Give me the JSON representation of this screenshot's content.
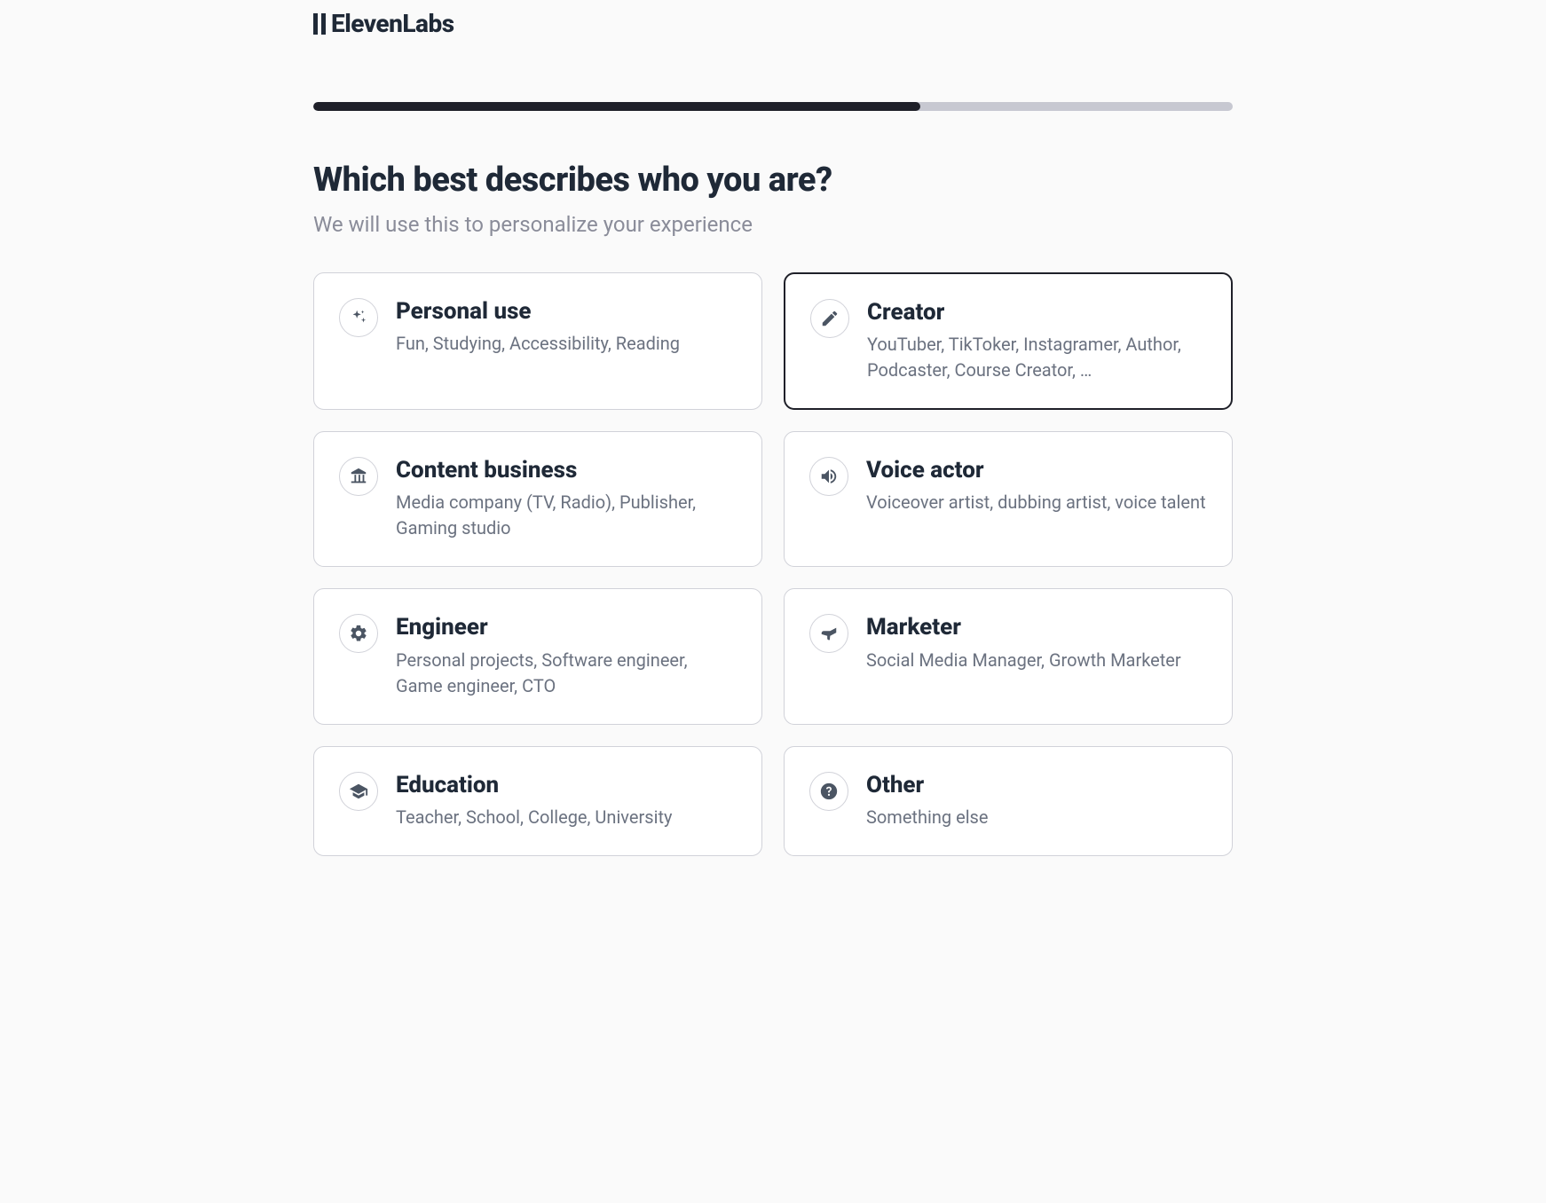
{
  "brand": "ElevenLabs",
  "progress": {
    "percent": 66
  },
  "heading": "Which best describes who you are?",
  "subheading": "We will use this to personalize your experience",
  "selected": "creator",
  "options": {
    "personal": {
      "title": "Personal use",
      "desc": "Fun, Studying, Accessibility, Reading"
    },
    "creator": {
      "title": "Creator",
      "desc": "YouTuber, TikToker, Instagramer, Author, Podcaster, Course Creator, …"
    },
    "content_business": {
      "title": "Content business",
      "desc": "Media company (TV, Radio), Publisher, Gaming studio"
    },
    "voice_actor": {
      "title": "Voice actor",
      "desc": "Voiceover artist, dubbing artist, voice talent"
    },
    "engineer": {
      "title": "Engineer",
      "desc": "Personal projects, Software engineer, Game engineer, CTO"
    },
    "marketer": {
      "title": "Marketer",
      "desc": "Social Media Manager, Growth Marketer"
    },
    "education": {
      "title": "Education",
      "desc": "Teacher, School, College, University"
    },
    "other": {
      "title": "Other",
      "desc": "Something else"
    }
  }
}
